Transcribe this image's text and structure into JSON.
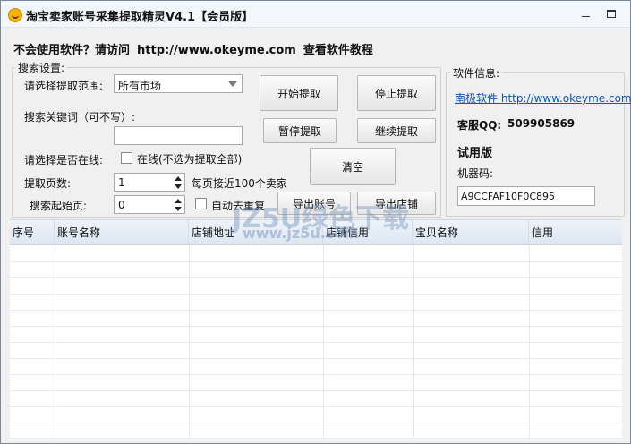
{
  "window": {
    "title": "淘宝卖家账号采集提取精灵V4.1【会员版】",
    "minimize_glyph": "_",
    "maximize_glyph": "□"
  },
  "help_bar": {
    "question": "不会使用软件？请访问",
    "url": "http://www.okeyme.com",
    "tutorial": "查看软件教程"
  },
  "search_settings": {
    "legend": "搜索设置:",
    "range_label": "请选择提取范围:",
    "range_value": "所有市场",
    "keyword_label": "搜索关键词（可不写）:",
    "keyword_value": "",
    "online_label": "请选择是否在线:",
    "online_checkbox_label": "在线(不选为提取全部)",
    "pages_label": "提取页数:",
    "pages_value": "1",
    "pages_hint": "每页接近100个卖家",
    "start_page_label": "搜索起始页:",
    "start_page_value": "0",
    "dedupe_label": "自动去重复"
  },
  "buttons": {
    "start": "开始提取",
    "stop": "停止提取",
    "pause": "暂停提取",
    "resume": "继续提取",
    "clear": "清空",
    "export_accounts": "导出账号",
    "export_shops": "导出店铺"
  },
  "software_info": {
    "legend": "软件信息:",
    "vendor": "南极软件",
    "url": "http://www.okeyme.com",
    "qq_label": "客服QQ:",
    "qq_value": "509905869",
    "edition": "试用版",
    "machine_label": "机器码:",
    "machine_code": "A9CCFAF10F0C895"
  },
  "table": {
    "columns": [
      "序号",
      "账号名称",
      "店铺地址",
      "店铺信用",
      "宝贝名称",
      "信用"
    ],
    "rows": []
  },
  "watermark": {
    "text": "JZ5U绿色下载",
    "url": "www.jz5u.com"
  },
  "colors": {
    "link": "#0a55b8",
    "window_bg": "#f0f0f0",
    "header_bg": "#dde6f1"
  }
}
